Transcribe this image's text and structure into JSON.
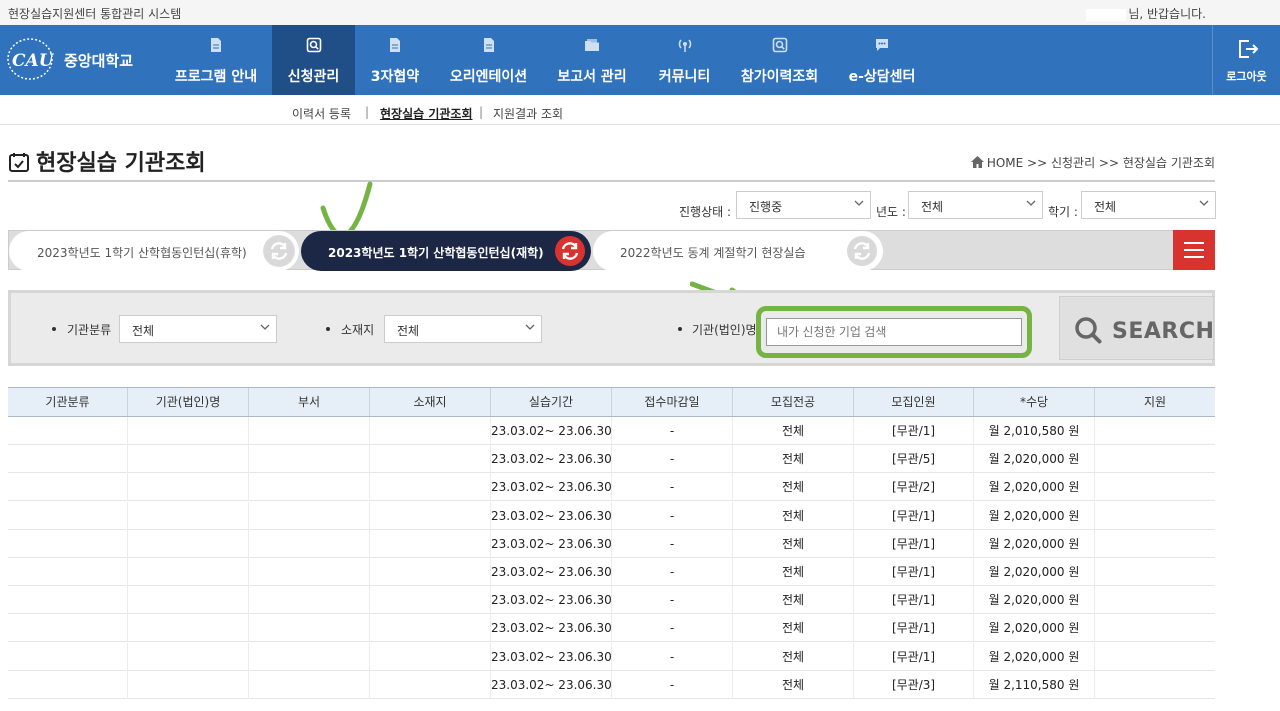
{
  "topbar": {
    "system_name": "현장실습지원센터 통합관리 시스템",
    "greeting": "님, 반갑습니다."
  },
  "nav": {
    "logo_text": "중앙대학교",
    "items": [
      {
        "label": "프로그램 안내",
        "icon": "document-icon"
      },
      {
        "label": "신청관리",
        "icon": "search-document-icon"
      },
      {
        "label": "3자협약",
        "icon": "document-icon"
      },
      {
        "label": "오리엔테이션",
        "icon": "document-icon"
      },
      {
        "label": "보고서 관리",
        "icon": "folder-icon"
      },
      {
        "label": "커뮤니티",
        "icon": "broadcast-icon"
      },
      {
        "label": "참가이력조회",
        "icon": "search-document-icon"
      },
      {
        "label": "e-상담센터",
        "icon": "chat-icon"
      }
    ],
    "active_index": 1,
    "logout_label": "로그아웃"
  },
  "submenu": {
    "items": [
      "이력서 등록",
      "현장실습 기관조회",
      "지원결과 조회"
    ],
    "current_index": 1
  },
  "page": {
    "title": "현장실습 기관조회",
    "breadcrumb": "HOME >>  신청관리 >> 현장실습 기관조회"
  },
  "filters": {
    "status_label": "진행상태 :",
    "status_value": "진행중",
    "year_label": "년도 :",
    "year_value": "전체",
    "term_label": "학기 :",
    "term_value": "전체"
  },
  "tabs": [
    "2023학년도 1학기 산학협동인턴십(휴학)",
    "2023학년도 1학기 산학협동인턴십(재학)",
    "2022학년도 동계 계절학기 현장실습"
  ],
  "search": {
    "category_label": "기관분류",
    "category_value": "전체",
    "location_label": "소재지",
    "location_value": "전체",
    "org_label": "기관(법인)명",
    "org_placeholder": "내가 신청한 기업 검색",
    "button_label": "SEARCH"
  },
  "table": {
    "headers": [
      "기관분류",
      "기관(법인)명",
      "부서",
      "소재지",
      "실습기간",
      "접수마감일",
      "모집전공",
      "모집인원",
      "*수당",
      "지원"
    ],
    "rows": [
      {
        "period": "23.03.02~ 23.06.30",
        "deadline": "-",
        "major": "전체",
        "count": "[무관/1]",
        "pay": "월 2,010,580 원"
      },
      {
        "period": "23.03.02~ 23.06.30",
        "deadline": "-",
        "major": "전체",
        "count": "[무관/5]",
        "pay": "월 2,020,000 원"
      },
      {
        "period": "23.03.02~ 23.06.30",
        "deadline": "-",
        "major": "전체",
        "count": "[무관/2]",
        "pay": "월 2,020,000 원"
      },
      {
        "period": "23.03.02~ 23.06.30",
        "deadline": "-",
        "major": "전체",
        "count": "[무관/1]",
        "pay": "월 2,020,000 원"
      },
      {
        "period": "23.03.02~ 23.06.30",
        "deadline": "-",
        "major": "전체",
        "count": "[무관/1]",
        "pay": "월 2,020,000 원"
      },
      {
        "period": "23.03.02~ 23.06.30",
        "deadline": "-",
        "major": "전체",
        "count": "[무관/1]",
        "pay": "월 2,020,000 원"
      },
      {
        "period": "23.03.02~ 23.06.30",
        "deadline": "-",
        "major": "전체",
        "count": "[무관/1]",
        "pay": "월 2,020,000 원"
      },
      {
        "period": "23.03.02~ 23.06.30",
        "deadline": "-",
        "major": "전체",
        "count": "[무관/1]",
        "pay": "월 2,020,000 원"
      },
      {
        "period": "23.03.02~ 23.06.30",
        "deadline": "-",
        "major": "전체",
        "count": "[무관/1]",
        "pay": "월 2,020,000 원"
      },
      {
        "period": "23.03.02~ 23.06.30",
        "deadline": "-",
        "major": "전체",
        "count": "[무관/3]",
        "pay": "월 2,110,580 원"
      }
    ]
  },
  "colors": {
    "nav": "#3072bc",
    "nav_active": "#1f4f86",
    "highlight": "#75b443",
    "accent_red": "#d8332e",
    "tab_active": "#1b2744"
  }
}
